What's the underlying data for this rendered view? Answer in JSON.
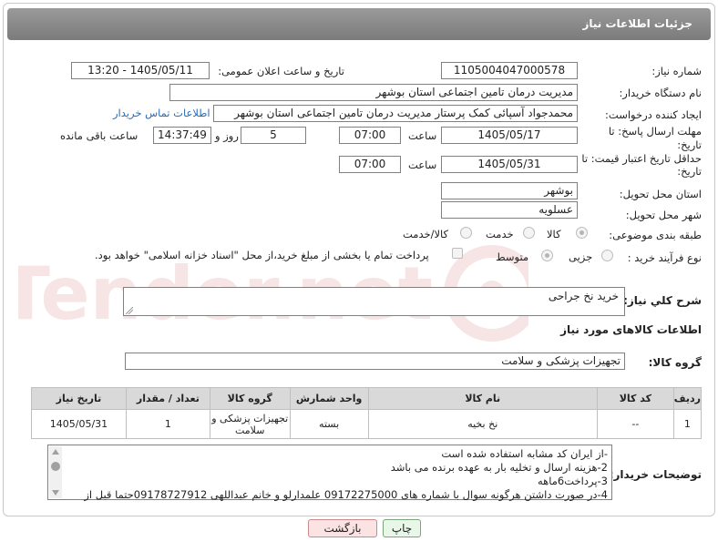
{
  "page": {
    "title": "جزئیات اطلاعات نیاز"
  },
  "labels": {
    "need_number": "شماره نیاز:",
    "announce_datetime": "تاریخ و ساعت اعلان عمومی:",
    "buyer_org": "نام دستگاه خریدار:",
    "requester": "ایجاد کننده درخواست:",
    "deadline": "مهلت ارسال پاسخ: تا تاریخ:",
    "price_validity": "حداقل تاریخ اعتبار قیمت: تا تاریخ:",
    "time": "ساعت",
    "days_and": "روز و",
    "remaining": "ساعت باقی مانده",
    "province": "استان محل تحویل:",
    "city": "شهر محل تحویل:",
    "category": "طبقه بندی موضوعی:",
    "process_type": "نوع فرآیند خرید :",
    "general_desc": "شرح کلي نياز:",
    "goods_info": "اطلاعات کالاهای مورد نیاز",
    "goods_group": "گروه کالا:",
    "buyer_notes": "توضیحات خریدار:"
  },
  "fields": {
    "need_number": "1105004047000578",
    "announce_datetime": "1405/05/11 - 13:20",
    "buyer_org": "مدیریت درمان تامین اجتماعی استان بوشهر",
    "requester": "محمدجواد آسپائی کمک پرستار مدیریت درمان تامین اجتماعی استان بوشهر",
    "deadline_date": "1405/05/17",
    "deadline_time": "07:00",
    "deadline_days": "5",
    "deadline_remaining": "14:37:49",
    "validity_date": "1405/05/31",
    "validity_time": "07:00",
    "province": "بوشهر",
    "city": "عسلویه",
    "general_desc": "خرید نخ جراحی",
    "goods_group": "تجهیزات پزشکی و سلامت"
  },
  "contact_link": "اطلاعات تماس خریدار",
  "category_options": [
    {
      "label": "کالا",
      "selected": true
    },
    {
      "label": "خدمت",
      "selected": false
    },
    {
      "label": "کالا/خدمت",
      "selected": false
    }
  ],
  "process_options": [
    {
      "label": "جزیی",
      "selected": false
    },
    {
      "label": "متوسط",
      "selected": true
    }
  ],
  "payment_note": "پرداخت تمام یا بخشی از مبلغ خرید،از محل \"اسناد خزانه اسلامی\" خواهد بود.",
  "table": {
    "headers": [
      "ردیف",
      "کد کالا",
      "نام کالا",
      "واحد شمارش",
      "گروه کالا",
      "تعداد / مقدار",
      "تاریخ نیاز"
    ],
    "rows": [
      [
        "1",
        "--",
        "نخ بخیه",
        "بسته",
        "تجهیزات پزشکی و سلامت",
        "1",
        "1405/05/31"
      ]
    ]
  },
  "notes": [
    "-از ایران کد مشابه استفاده شده است",
    "2-هزینه ارسال و تخلیه بار به عهده برنده می باشد",
    "3-پرداخت6ماهه",
    "4-در صورت داشتن هرگونه سوال با شماره های 09172275000 علمدارلو و خانم عبداللهی 09178727912حتما قبل از"
  ],
  "buttons": {
    "print": "چاپ",
    "back": "بازگشت"
  },
  "watermark_text": "AriaTender.net",
  "colors": {
    "header": "#8a8a8a",
    "link": "#2a6db3",
    "print_btn": "#e9f7e9",
    "back_btn": "#fbe3e3"
  }
}
